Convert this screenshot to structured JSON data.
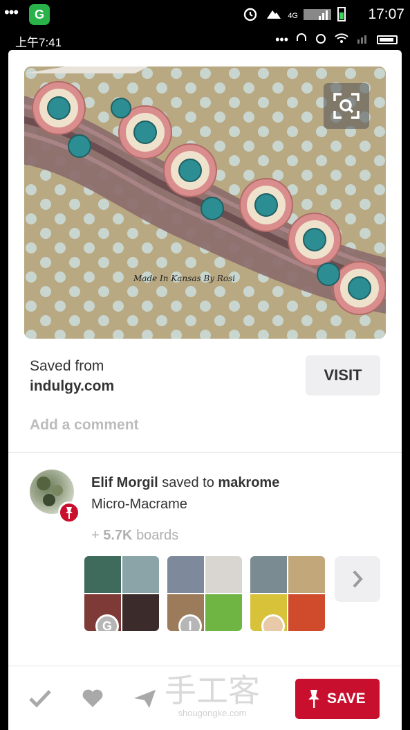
{
  "status_bar": {
    "dots": "•••",
    "app_badge": "G",
    "network": "4G",
    "time": "17:07",
    "secondary_time": "上午7:41",
    "secondary_dots": "•••"
  },
  "pin": {
    "image_caption": "Made In Kansas By Rosi",
    "saved_from_label": "Saved from",
    "source_domain": "indulgy.com",
    "visit_label": "VISIT",
    "comment_placeholder": "Add a comment"
  },
  "activity": {
    "user_name": "Elif Morgil",
    "saved_to_text": "saved to",
    "board_name": "makrome",
    "pin_title": "Micro-Macrame",
    "plus_prefix": "+",
    "boards_count": "5.7K",
    "boards_suffix": "boards"
  },
  "boards": [
    {
      "owner_initial": "G",
      "colors": [
        "#3e6b5c",
        "#8aa4a7",
        "#7d3a36",
        "#3b2b2a"
      ]
    },
    {
      "owner_initial": "I",
      "colors": [
        "#7e8a9b",
        "#d9d6d1",
        "#9c7b5a",
        "#6fb544"
      ]
    },
    {
      "owner_initial": "",
      "colors": [
        "#7a8b92",
        "#c2a77a",
        "#d7c23a",
        "#d04a2c"
      ]
    }
  ],
  "bottom_bar": {
    "save_label": "SAVE",
    "watermark_big": "手工客",
    "watermark_small": "shougongke.com"
  },
  "colors": {
    "brand_red": "#c8102e",
    "button_grey": "#efeff2",
    "muted_text": "#bcbcbc"
  },
  "icons": [
    "search-lens-icon",
    "pin-icon",
    "chevron-right-icon",
    "check-icon",
    "heart-icon",
    "send-icon",
    "wifi-icon",
    "alarm-icon",
    "battery-icon"
  ]
}
